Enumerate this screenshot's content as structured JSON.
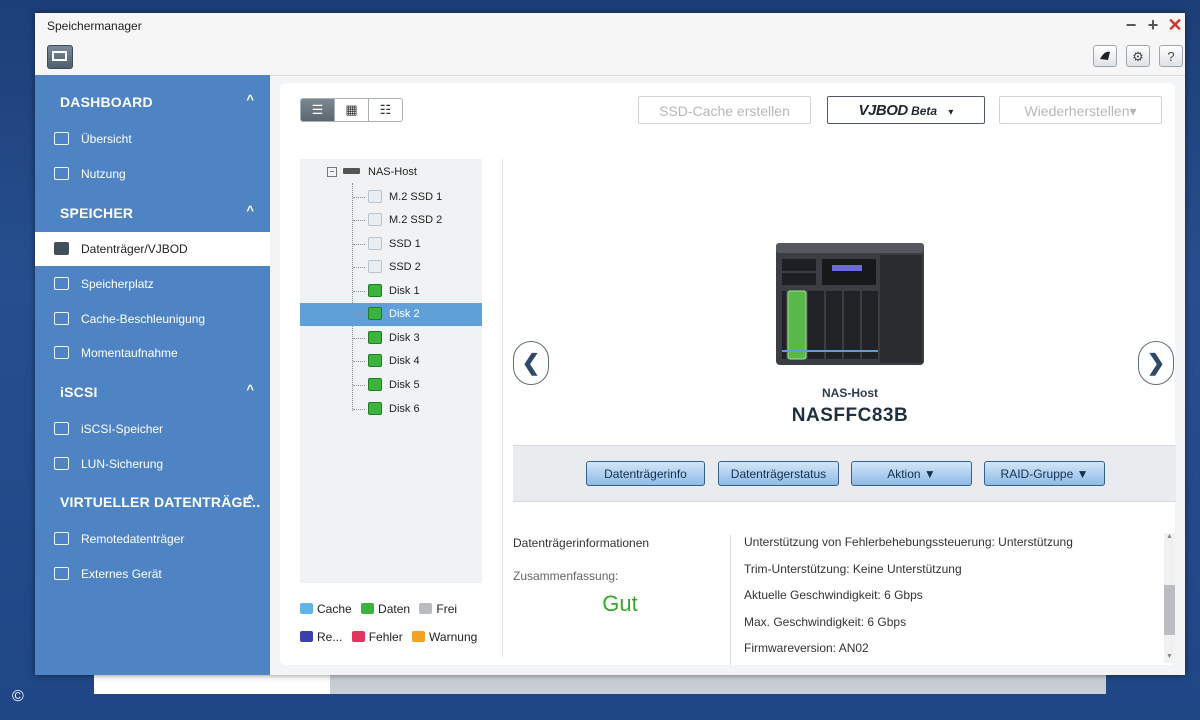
{
  "window": {
    "title": "Speichermanager",
    "controls": {
      "minimize": "−",
      "maximize": "+",
      "close": "✕"
    },
    "tool_buttons": {
      "account_icon": "account-icon",
      "settings_icon": "gear-icon",
      "help": "?"
    }
  },
  "sidebar": {
    "sections": [
      {
        "label": "DASHBOARD",
        "chevron": "^",
        "items": [
          {
            "label": "Übersicht",
            "icon": "overview-icon"
          },
          {
            "label": "Nutzung",
            "icon": "usage-chart-icon"
          }
        ]
      },
      {
        "label": "SPEICHER",
        "chevron": "^",
        "items": [
          {
            "label": "Datenträger/VJBOD",
            "icon": "disk-icon",
            "active": true
          },
          {
            "label": "Speicherplatz",
            "icon": "storage-icon"
          },
          {
            "label": "Cache-Beschleunigung",
            "icon": "cache-icon"
          },
          {
            "label": "Momentaufnahme",
            "icon": "snapshot-icon"
          }
        ]
      },
      {
        "label": "iSCSI",
        "chevron": "^",
        "items": [
          {
            "label": "iSCSI-Speicher",
            "icon": "iscsi-icon"
          },
          {
            "label": "LUN-Sicherung",
            "icon": "lun-backup-icon"
          }
        ]
      },
      {
        "label": "VIRTUELLER DATENTRÄGE..",
        "chevron": "^",
        "items": [
          {
            "label": "Remotedatenträger",
            "icon": "remote-disk-icon"
          },
          {
            "label": "Externes Gerät",
            "icon": "external-device-icon"
          }
        ]
      }
    ]
  },
  "toolbar": {
    "view_modes": [
      "☰",
      "▦",
      "☷"
    ],
    "ssd_cache": "SSD-Cache erstellen",
    "vjbod": "VJBOD",
    "vjbod_beta": "Beta",
    "vjbod_arrow": "▾",
    "restore": "Wiederherstellen▾"
  },
  "tree": {
    "root": "NAS-Host",
    "root_toggle": "−",
    "items": [
      {
        "label": "M.2 SSD 1",
        "type": "empty"
      },
      {
        "label": "M.2 SSD 2",
        "type": "empty"
      },
      {
        "label": "SSD 1",
        "type": "empty"
      },
      {
        "label": "SSD 2",
        "type": "empty"
      },
      {
        "label": "Disk 1",
        "type": "disk"
      },
      {
        "label": "Disk 2",
        "type": "disk",
        "selected": true
      },
      {
        "label": "Disk 3",
        "type": "disk"
      },
      {
        "label": "Disk 4",
        "type": "disk"
      },
      {
        "label": "Disk 5",
        "type": "disk"
      },
      {
        "label": "Disk 6",
        "type": "disk"
      }
    ]
  },
  "legend": {
    "row1": [
      {
        "label": "Cache",
        "color": "#5fb6e6"
      },
      {
        "label": "Daten",
        "color": "#3bb33c"
      },
      {
        "label": "Frei",
        "color": "#b8bcc0"
      }
    ],
    "row2": [
      {
        "label": "Re...",
        "color": "#3a3fae"
      },
      {
        "label": "Fehler",
        "color": "#e0365d"
      },
      {
        "label": "Warnung",
        "color": "#f2a026"
      }
    ]
  },
  "device": {
    "subtitle": "NAS-Host",
    "name": "NASFFC83B",
    "prev": "❮",
    "next": "❯"
  },
  "actions": {
    "info": "Datenträgerinfo",
    "status": "Datenträgerstatus",
    "action": "Aktion ▼",
    "raid": "RAID-Gruppe ▼"
  },
  "info": {
    "title": "Datenträgerinformationen",
    "summary_label": "Zusammenfassung:",
    "summary_value": "Gut",
    "lines": [
      "Unterstützung von Fehlerbehebungssteuerung: Unterstützung",
      "Trim-Unterstützung: Keine Unterstützung",
      "Aktuelle Geschwindigkeit: 6 Gbps",
      "Max. Geschwindigkeit: 6 Gbps",
      "Firmwareversion: AN02"
    ]
  },
  "footer": {
    "copyright": "©"
  }
}
